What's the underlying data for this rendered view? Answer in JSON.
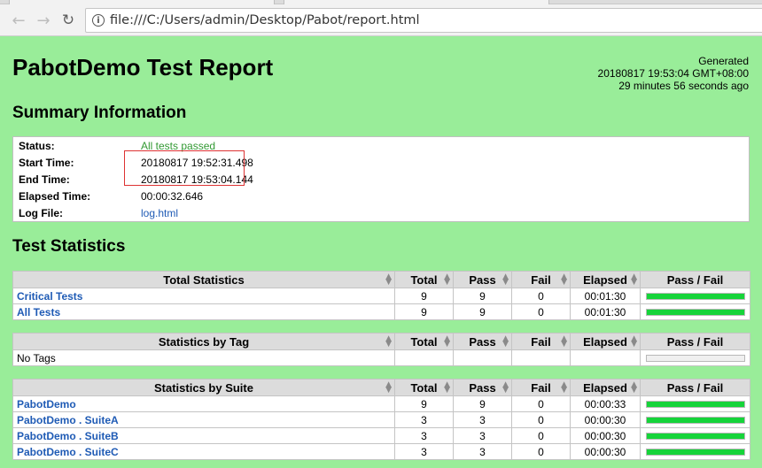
{
  "browser": {
    "url": "file:///C:/Users/admin/Desktop/Pabot/report.html"
  },
  "report": {
    "title": "PabotDemo Test Report",
    "generated_label": "Generated",
    "generated_time": "20180817 19:53:04 GMT+08:00",
    "generated_ago": "29 minutes 56 seconds ago"
  },
  "summary": {
    "heading": "Summary Information",
    "rows": [
      {
        "label": "Status:",
        "value": "All tests passed"
      },
      {
        "label": "Start Time:",
        "value": "20180817 19:52:31.498"
      },
      {
        "label": "End Time:",
        "value": "20180817 19:53:04.144"
      },
      {
        "label": "Elapsed Time:",
        "value": "00:00:32.646"
      },
      {
        "label": "Log File:",
        "value": "log.html"
      }
    ]
  },
  "statistics": {
    "heading": "Test Statistics",
    "columns": [
      "Total",
      "Pass",
      "Fail",
      "Elapsed",
      "Pass / Fail"
    ],
    "total": {
      "header": "Total Statistics",
      "rows": [
        {
          "name": "Critical Tests",
          "total": "9",
          "pass": "9",
          "fail": "0",
          "elapsed": "00:01:30",
          "pass_ratio": 1
        },
        {
          "name": "All Tests",
          "total": "9",
          "pass": "9",
          "fail": "0",
          "elapsed": "00:01:30",
          "pass_ratio": 1
        }
      ]
    },
    "tag": {
      "header": "Statistics by Tag",
      "rows": [
        {
          "name": "No Tags",
          "total": "",
          "pass": "",
          "fail": "",
          "elapsed": "",
          "pass_ratio": 0
        }
      ]
    },
    "suite": {
      "header": "Statistics by Suite",
      "rows": [
        {
          "name": "PabotDemo",
          "total": "9",
          "pass": "9",
          "fail": "0",
          "elapsed": "00:00:33",
          "pass_ratio": 1
        },
        {
          "name": "PabotDemo . SuiteA",
          "total": "3",
          "pass": "3",
          "fail": "0",
          "elapsed": "00:00:30",
          "pass_ratio": 1
        },
        {
          "name": "PabotDemo . SuiteB",
          "total": "3",
          "pass": "3",
          "fail": "0",
          "elapsed": "00:00:30",
          "pass_ratio": 1
        },
        {
          "name": "PabotDemo . SuiteC",
          "total": "3",
          "pass": "3",
          "fail": "0",
          "elapsed": "00:00:30",
          "pass_ratio": 1
        }
      ]
    }
  },
  "colors": {
    "background": "#99ed99",
    "pass_bar": "#16d43a",
    "link": "#1f5bb5",
    "pass_text": "#339933",
    "highlight": "#dd3333"
  },
  "icons": {
    "back": "back-arrow-icon",
    "forward": "forward-arrow-icon",
    "reload": "reload-icon",
    "info": "info-icon",
    "sort": "sort-arrows-icon"
  }
}
